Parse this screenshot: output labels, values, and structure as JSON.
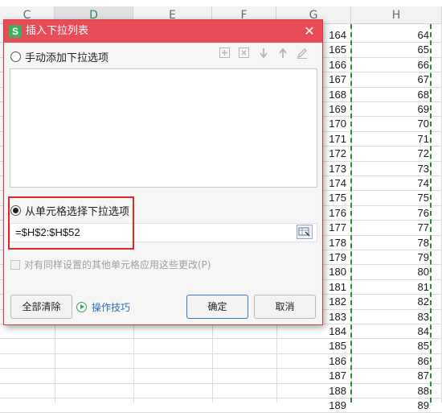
{
  "sheet": {
    "columns": [
      "C",
      "D",
      "E",
      "F",
      "G",
      "H"
    ],
    "active_column": "D",
    "g_values": [
      "164",
      "165",
      "166",
      "167",
      "168",
      "169",
      "170",
      "171",
      "172",
      "173",
      "174",
      "175",
      "176",
      "177",
      "178",
      "179",
      "180",
      "181",
      "182",
      "183",
      "184",
      "185",
      "186",
      "187",
      "188",
      "189"
    ],
    "h_values": [
      "64",
      "65",
      "66",
      "67",
      "68",
      "69",
      "70",
      "71",
      "72",
      "73",
      "74",
      "75",
      "76",
      "77",
      "78",
      "79",
      "80",
      "81",
      "82",
      "83",
      "84",
      "85",
      "86",
      "87",
      "88",
      "89"
    ]
  },
  "dialog": {
    "title": "插入下拉列表",
    "app_icon_letter": "S",
    "close_label": "✕",
    "option_manual": "手动添加下拉选项",
    "option_from_cells": "从单元格选择下拉选项",
    "selected_option": "from_cells",
    "range_value": "=$H$2:$H$52",
    "apply_all_label": "对有同样设置的其他单元格应用这些更改(P)",
    "clear_all_label": "全部清除",
    "tips_label": "操作技巧",
    "ok_label": "确定",
    "cancel_label": "取消",
    "accent_color": "#e84c57"
  },
  "toolbar_icons": [
    "add-item-icon",
    "delete-item-icon",
    "move-down-icon",
    "move-up-icon",
    "edit-item-icon"
  ]
}
